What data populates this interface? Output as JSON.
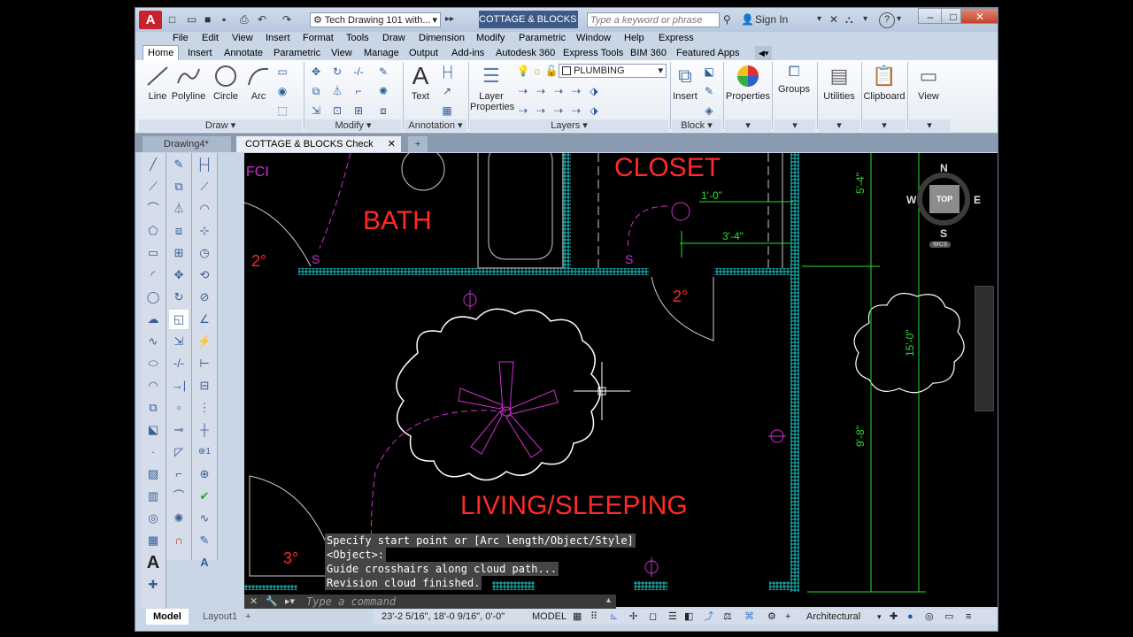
{
  "title_bar": {
    "logo": "A",
    "workspace_combo": "Tech Drawing 101 with...",
    "document_title": "COTTAGE & BLOCKS C...",
    "search_placeholder": "Type a keyword or phrase",
    "sign_in": "Sign In",
    "help": "?",
    "minimize": "–",
    "maximize": "□",
    "close": "✕"
  },
  "menu": [
    "File",
    "Edit",
    "View",
    "Insert",
    "Format",
    "Tools",
    "Draw",
    "Dimension",
    "Modify",
    "Parametric",
    "Window",
    "Help",
    "Express"
  ],
  "ribbon_tabs": [
    "Home",
    "Insert",
    "Annotate",
    "Parametric",
    "View",
    "Manage",
    "Output",
    "Add-ins",
    "Autodesk 360",
    "Express Tools",
    "BIM 360",
    "Featured Apps"
  ],
  "ribbon": {
    "draw": {
      "line": "Line",
      "polyline": "Polyline",
      "circle": "Circle",
      "arc": "Arc",
      "panel": "Draw ▾"
    },
    "modify": {
      "panel": "Modify ▾"
    },
    "annotation": {
      "text": "Text",
      "panel": "Annotation ▾"
    },
    "layers": {
      "layer_properties_1": "Layer",
      "layer_properties_2": "Properties",
      "current_layer": "PLUMBING",
      "panel": "Layers ▾"
    },
    "block": {
      "insert": "Insert",
      "panel": "Block ▾"
    },
    "properties": "Properties",
    "groups": "Groups",
    "utilities": "Utilities",
    "clipboard": "Clipboard",
    "view": "View"
  },
  "doc_tabs": [
    {
      "label": "Drawing4*"
    },
    {
      "label": "COTTAGE & BLOCKS Check Print*",
      "close": "✕"
    }
  ],
  "drawing": {
    "rooms": [
      "BATH",
      "CLOSET",
      "LIVING/SLEEPING"
    ],
    "tag_fci": "FCI",
    "door_tags": [
      "2°",
      "2°",
      "3°"
    ],
    "switch_symbol": "S",
    "dims": [
      "1'-0\"",
      "3'-4\"",
      "5'-4\"",
      "15'-0\"",
      "9'-8\""
    ],
    "viewcube": {
      "n": "N",
      "s": "S",
      "e": "E",
      "w": "W",
      "top": "TOP",
      "wcs": "WCS"
    }
  },
  "command": {
    "history": [
      "Specify start point or [Arc length/Object/Style]",
      "<Object>:",
      "Guide crosshairs along cloud path...",
      "Revision cloud finished."
    ],
    "placeholder": "Type a command"
  },
  "layout_tabs": [
    "Model",
    "Layout1"
  ],
  "status": {
    "coords": "23'-2 5/16\", 18'-0 9/16\", 0'-0\"",
    "model": "MODEL",
    "units": "Architectural"
  },
  "colors": {
    "accent": "#3e5a86",
    "room_text": "#ff2a2a",
    "dim": "#25e025",
    "magenta": "#d030d0",
    "wall": "#1ec8c8"
  }
}
